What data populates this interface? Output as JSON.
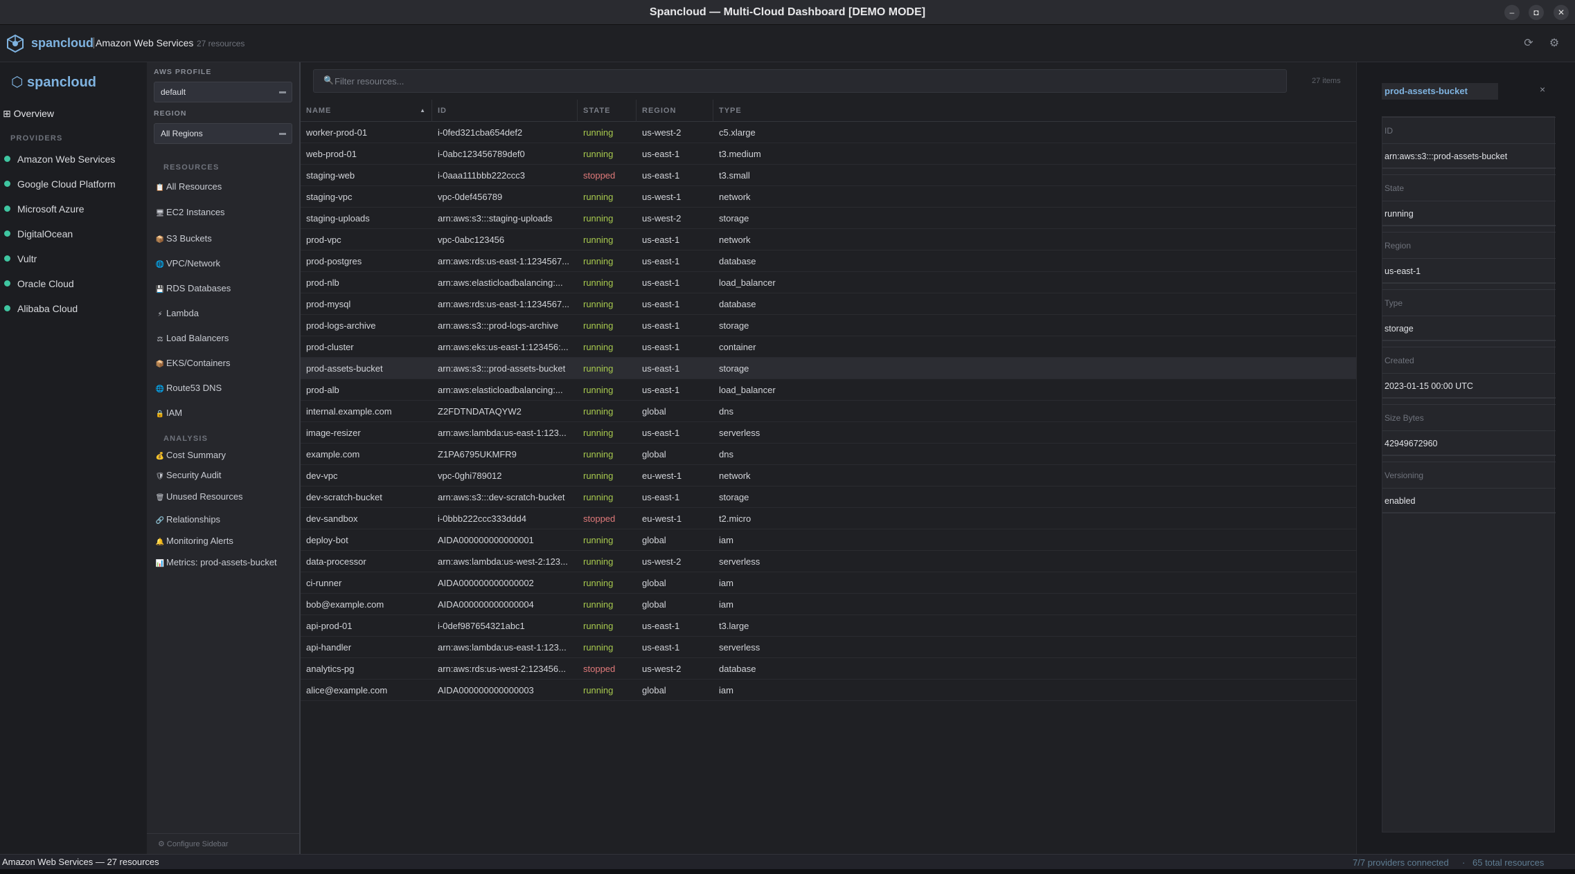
{
  "window": {
    "title": "Spancloud — Multi-Cloud Dashboard  [DEMO MODE]",
    "controls": [
      "minimize",
      "maximize",
      "close"
    ]
  },
  "header": {
    "logo_text": "spancloud",
    "breadcrumb": "Amazon Web Services",
    "resource_count": "27 resources"
  },
  "sidebar": {
    "logo_text": "⬡ spancloud",
    "overview_label": "⊞ Overview",
    "providers_heading": "PROVIDERS",
    "providers": [
      {
        "label": "Amazon Web Services"
      },
      {
        "label": "Google Cloud Platform"
      },
      {
        "label": "Microsoft Azure"
      },
      {
        "label": "DigitalOcean"
      },
      {
        "label": "Vultr"
      },
      {
        "label": "Oracle Cloud"
      },
      {
        "label": "Alibaba Cloud"
      }
    ],
    "status_color": "#3fc6a1"
  },
  "aws_panel": {
    "profile_label": "AWS PROFILE",
    "profile_value": "default",
    "region_label": "REGION",
    "region_value": "All Regions",
    "resources_heading": "RESOURCES",
    "resources": [
      {
        "icon": "📋",
        "label": "All Resources"
      },
      {
        "icon": "🖥",
        "label": "EC2 Instances"
      },
      {
        "icon": "📦",
        "label": "S3 Buckets"
      },
      {
        "icon": "🌐",
        "label": "VPC/Network"
      },
      {
        "icon": "💾",
        "label": "RDS Databases"
      },
      {
        "icon": "⚡",
        "label": "Lambda"
      },
      {
        "icon": "⚖",
        "label": "Load Balancers"
      },
      {
        "icon": "📦",
        "label": "EKS/Containers"
      },
      {
        "icon": "🌐",
        "label": "Route53 DNS"
      },
      {
        "icon": "🔒",
        "label": "IAM"
      }
    ],
    "analysis_heading": "ANALYSIS",
    "analysis": [
      {
        "icon": "💰",
        "label": "Cost Summary"
      },
      {
        "icon": "🛡",
        "label": "Security Audit"
      },
      {
        "icon": "🗑",
        "label": "Unused Resources"
      },
      {
        "icon": "🔗",
        "label": "Relationships"
      },
      {
        "icon": "🔔",
        "label": "Monitoring Alerts"
      },
      {
        "icon": "📊",
        "label": "Metrics: prod-assets-bucket"
      }
    ],
    "footer_label": "⚙ Configure Sidebar"
  },
  "table": {
    "filter_placeholder": "Filter resources...",
    "items_count": "27 items",
    "columns": [
      "NAME",
      "ID",
      "STATE",
      "REGION",
      "TYPE"
    ],
    "sorted_column": "NAME",
    "selected_row": "prod-assets-bucket",
    "rows": [
      {
        "name": "worker-prod-01",
        "id": "i-0fed321cba654def2",
        "state": "running",
        "region": "us-west-2",
        "type": "c5.xlarge"
      },
      {
        "name": "web-prod-01",
        "id": "i-0abc123456789def0",
        "state": "running",
        "region": "us-east-1",
        "type": "t3.medium"
      },
      {
        "name": "staging-web",
        "id": "i-0aaa111bbb222ccc3",
        "state": "stopped",
        "region": "us-east-1",
        "type": "t3.small"
      },
      {
        "name": "staging-vpc",
        "id": "vpc-0def456789",
        "state": "running",
        "region": "us-west-1",
        "type": "network"
      },
      {
        "name": "staging-uploads",
        "id": "arn:aws:s3:::staging-uploads",
        "state": "running",
        "region": "us-west-2",
        "type": "storage"
      },
      {
        "name": "prod-vpc",
        "id": "vpc-0abc123456",
        "state": "running",
        "region": "us-east-1",
        "type": "network"
      },
      {
        "name": "prod-postgres",
        "id": "arn:aws:rds:us-east-1:1234567...",
        "state": "running",
        "region": "us-east-1",
        "type": "database"
      },
      {
        "name": "prod-nlb",
        "id": "arn:aws:elasticloadbalancing:...",
        "state": "running",
        "region": "us-east-1",
        "type": "load_balancer"
      },
      {
        "name": "prod-mysql",
        "id": "arn:aws:rds:us-east-1:1234567...",
        "state": "running",
        "region": "us-east-1",
        "type": "database"
      },
      {
        "name": "prod-logs-archive",
        "id": "arn:aws:s3:::prod-logs-archive",
        "state": "running",
        "region": "us-east-1",
        "type": "storage"
      },
      {
        "name": "prod-cluster",
        "id": "arn:aws:eks:us-east-1:123456:...",
        "state": "running",
        "region": "us-east-1",
        "type": "container"
      },
      {
        "name": "prod-assets-bucket",
        "id": "arn:aws:s3:::prod-assets-bucket",
        "state": "running",
        "region": "us-east-1",
        "type": "storage"
      },
      {
        "name": "prod-alb",
        "id": "arn:aws:elasticloadbalancing:...",
        "state": "running",
        "region": "us-east-1",
        "type": "load_balancer"
      },
      {
        "name": "internal.example.com",
        "id": "Z2FDTNDATAQYW2",
        "state": "running",
        "region": "global",
        "type": "dns"
      },
      {
        "name": "image-resizer",
        "id": "arn:aws:lambda:us-east-1:123...",
        "state": "running",
        "region": "us-east-1",
        "type": "serverless"
      },
      {
        "name": "example.com",
        "id": "Z1PA6795UKMFR9",
        "state": "running",
        "region": "global",
        "type": "dns"
      },
      {
        "name": "dev-vpc",
        "id": "vpc-0ghi789012",
        "state": "running",
        "region": "eu-west-1",
        "type": "network"
      },
      {
        "name": "dev-scratch-bucket",
        "id": "arn:aws:s3:::dev-scratch-bucket",
        "state": "running",
        "region": "us-east-1",
        "type": "storage"
      },
      {
        "name": "dev-sandbox",
        "id": "i-0bbb222ccc333ddd4",
        "state": "stopped",
        "region": "eu-west-1",
        "type": "t2.micro"
      },
      {
        "name": "deploy-bot",
        "id": "AIDA000000000000001",
        "state": "running",
        "region": "global",
        "type": "iam"
      },
      {
        "name": "data-processor",
        "id": "arn:aws:lambda:us-west-2:123...",
        "state": "running",
        "region": "us-west-2",
        "type": "serverless"
      },
      {
        "name": "ci-runner",
        "id": "AIDA000000000000002",
        "state": "running",
        "region": "global",
        "type": "iam"
      },
      {
        "name": "bob@example.com",
        "id": "AIDA000000000000004",
        "state": "running",
        "region": "global",
        "type": "iam"
      },
      {
        "name": "api-prod-01",
        "id": "i-0def987654321abc1",
        "state": "running",
        "region": "us-east-1",
        "type": "t3.large"
      },
      {
        "name": "api-handler",
        "id": "arn:aws:lambda:us-east-1:123...",
        "state": "running",
        "region": "us-east-1",
        "type": "serverless"
      },
      {
        "name": "analytics-pg",
        "id": "arn:aws:rds:us-west-2:123456...",
        "state": "stopped",
        "region": "us-west-2",
        "type": "database"
      },
      {
        "name": "alice@example.com",
        "id": "AIDA000000000000003",
        "state": "running",
        "region": "global",
        "type": "iam"
      }
    ],
    "state_colors": {
      "running": "#a7c94e",
      "stopped": "#e07a7a"
    }
  },
  "details": {
    "title": "prod-assets-bucket",
    "close_glyph": "×",
    "fields": [
      {
        "label": "ID",
        "value": "arn:aws:s3:::prod-assets-bucket"
      },
      {
        "label": "State",
        "value": "running"
      },
      {
        "label": "Region",
        "value": "us-east-1"
      },
      {
        "label": "Type",
        "value": "storage"
      },
      {
        "label": "Created",
        "value": "2023-01-15 00:00 UTC"
      },
      {
        "label": "Size Bytes",
        "value": "42949672960"
      },
      {
        "label": "Versioning",
        "value": "enabled"
      }
    ]
  },
  "statusbar": {
    "left": "Amazon Web Services — 27 resources",
    "providers_connected": "7/7 providers connected",
    "separator": "·",
    "total_resources": "65 total resources"
  },
  "colors": {
    "accent": "#7fb3e0",
    "background": "#1b1c20"
  }
}
